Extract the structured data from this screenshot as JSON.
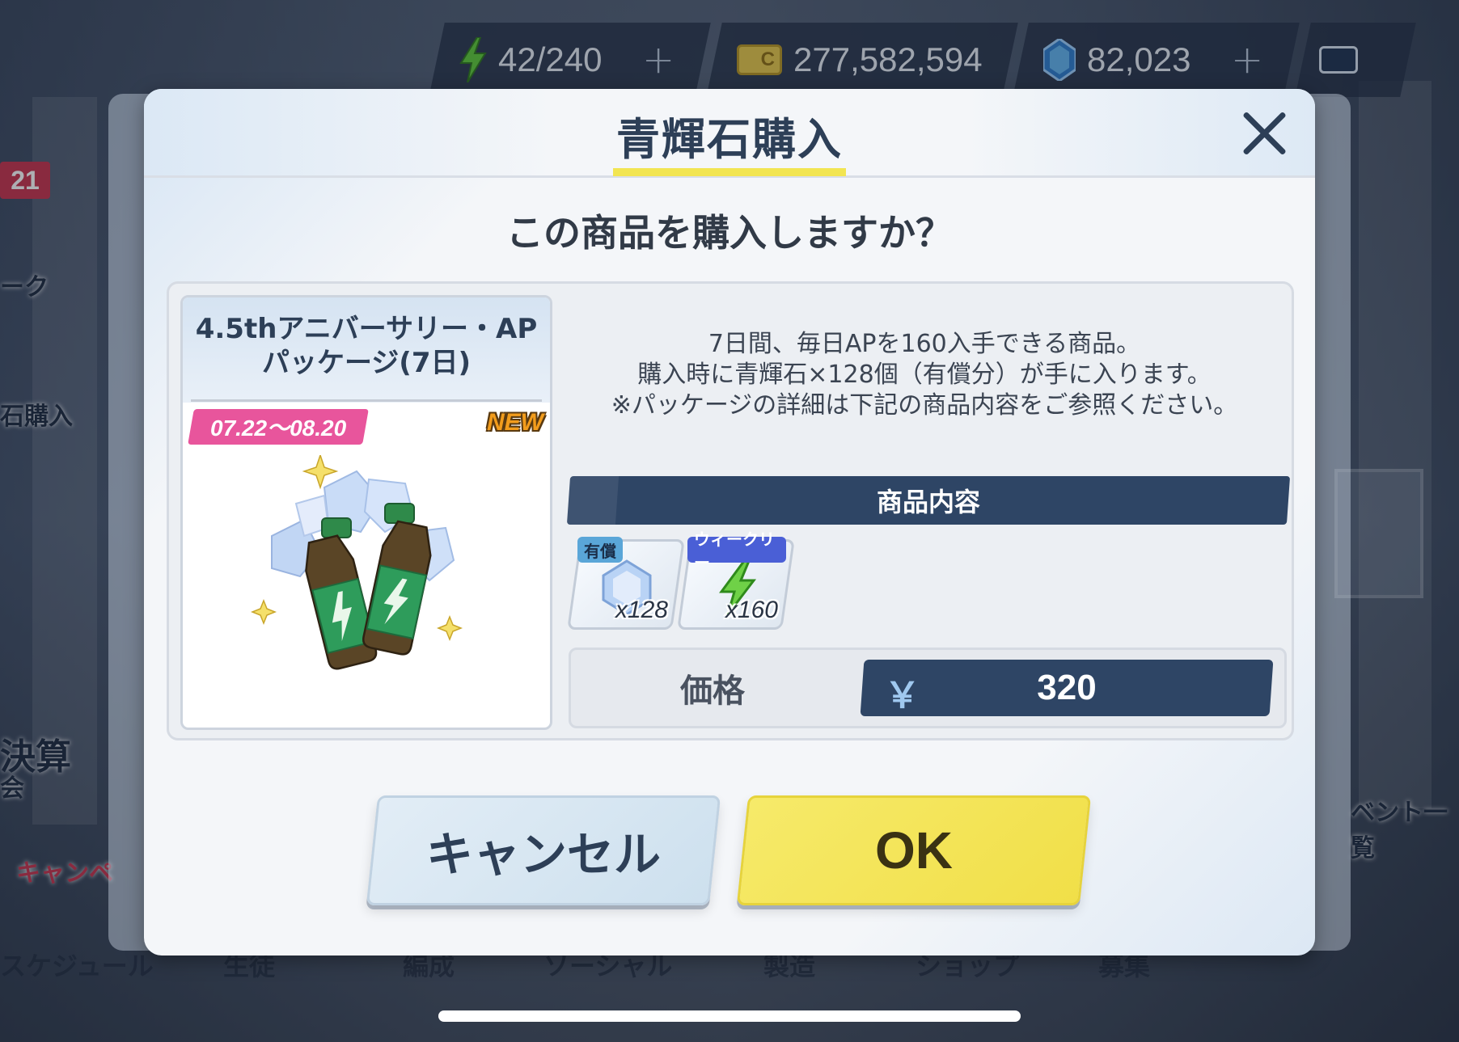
{
  "resources": {
    "ap": "42/240",
    "credits": "277,582,594",
    "pyroxene": "82,023",
    "plus": "+"
  },
  "background": {
    "badge_count": "21",
    "side_labels": [
      "ーク",
      "石購入",
      "決算",
      "会",
      "キャンペ"
    ],
    "right_label": "ベント一覧",
    "nav_items": [
      "スケジュール",
      "生徒",
      "編成",
      "ソーシャル",
      "製造",
      "ショップ",
      "募集"
    ]
  },
  "dialog": {
    "title": "青輝石購入",
    "question": "この商品を購入しますか？",
    "product": {
      "title_line1": "4.5thアニバーサリー・AP",
      "title_line2": "パッケージ(7日)",
      "date_range": "07.22～08.20",
      "new_label": "NEW"
    },
    "description_lines": [
      "7日間、毎日APを160入手できる商品。",
      "購入時に青輝石×128個（有償分）が手に入ります。",
      "※パッケージの詳細は下記の商品内容をご参照ください。"
    ],
    "contents_header": "商品内容",
    "items": [
      {
        "tag": "有償",
        "qty": "x128",
        "icon": "pyroxene-icon"
      },
      {
        "tag": "ウィークリー",
        "qty": "x160",
        "icon": "ap-icon"
      }
    ],
    "price_label": "価格",
    "currency": "￥",
    "price": "320",
    "cancel_label": "キャンセル",
    "ok_label": "OK"
  },
  "colors": {
    "accent_yellow": "#f2e552",
    "navy": "#2e4565",
    "pink_badge": "#e8559c",
    "ok_button": "#f4e35a"
  }
}
